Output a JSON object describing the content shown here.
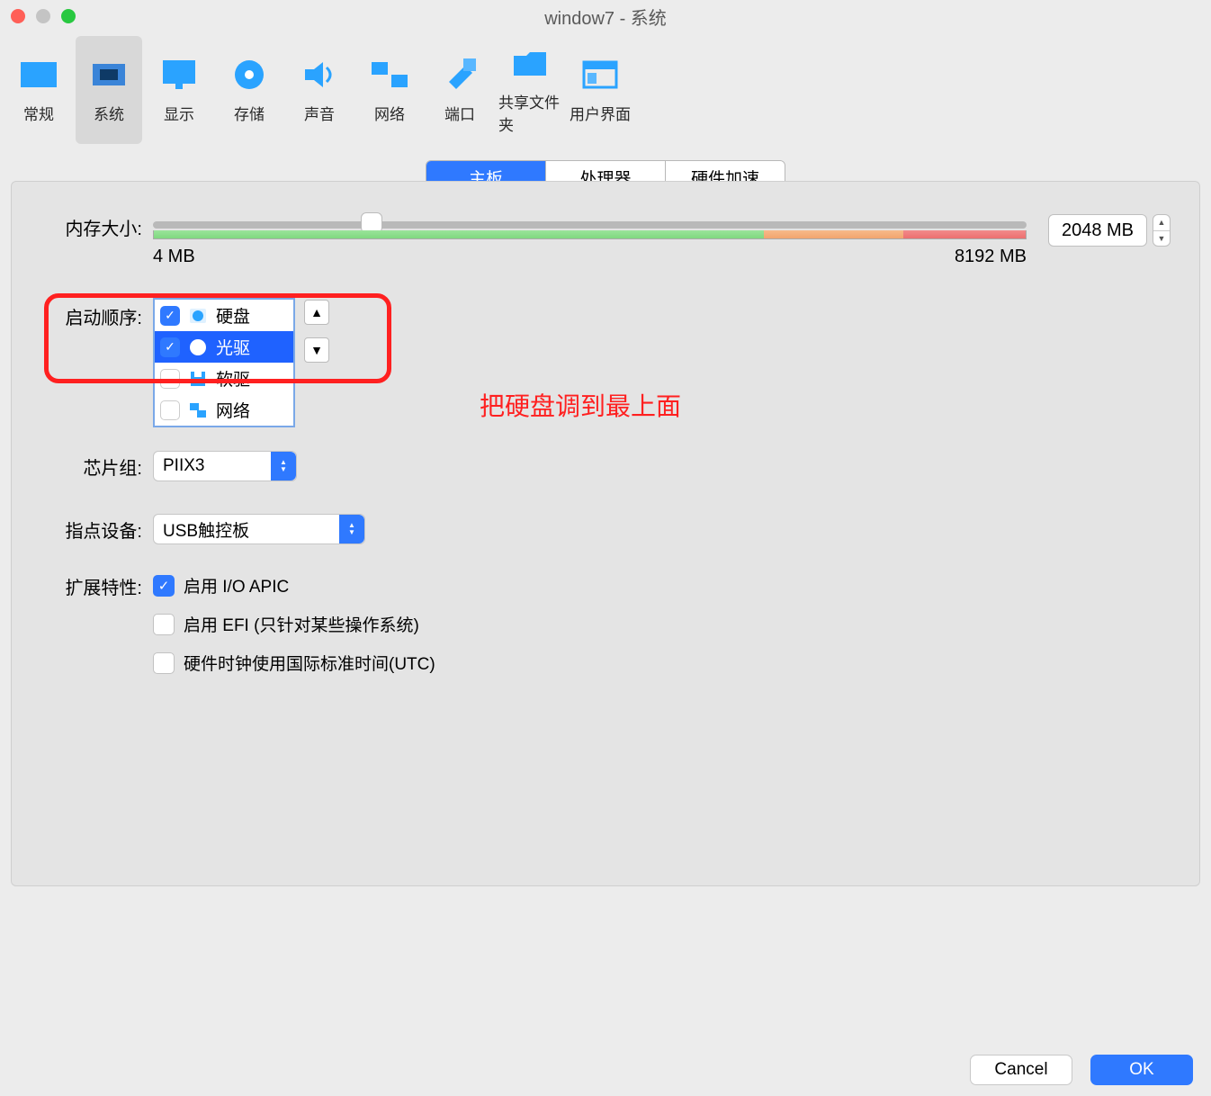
{
  "window": {
    "title": "window7 - 系统"
  },
  "toolbar": [
    {
      "label": "常规",
      "icon": "general"
    },
    {
      "label": "系统",
      "icon": "system",
      "active": true
    },
    {
      "label": "显示",
      "icon": "display"
    },
    {
      "label": "存储",
      "icon": "storage"
    },
    {
      "label": "声音",
      "icon": "audio"
    },
    {
      "label": "网络",
      "icon": "network"
    },
    {
      "label": "端口",
      "icon": "ports"
    },
    {
      "label": "共享文件夹",
      "icon": "shared"
    },
    {
      "label": "用户界面",
      "icon": "ui"
    }
  ],
  "tabs": [
    {
      "label": "主板",
      "active": true
    },
    {
      "label": "处理器",
      "active": false
    },
    {
      "label": "硬件加速",
      "active": false
    }
  ],
  "memory": {
    "label": "内存大小:",
    "value": "2048 MB",
    "min_label": "4 MB",
    "max_label": "8192 MB",
    "thumb_percent": 25,
    "gradient": {
      "green": 70,
      "orange": 16,
      "red": 14
    }
  },
  "boot": {
    "label": "启动顺序:",
    "items": [
      {
        "label": "硬盘",
        "checked": true,
        "selected": false,
        "icon": "hdd"
      },
      {
        "label": "光驱",
        "checked": true,
        "selected": true,
        "icon": "optical"
      },
      {
        "label": "软驱",
        "checked": false,
        "selected": false,
        "icon": "floppy"
      },
      {
        "label": "网络",
        "checked": false,
        "selected": false,
        "icon": "net"
      }
    ]
  },
  "annotation": "把硬盘调到最上面",
  "chipset": {
    "label": "芯片组:",
    "value": "PIIX3"
  },
  "pointing": {
    "label": "指点设备:",
    "value": "USB触控板"
  },
  "extended": {
    "label": "扩展特性:",
    "items": [
      {
        "label": "启用 I/O APIC",
        "checked": true
      },
      {
        "label": "启用 EFI (只针对某些操作系统)",
        "checked": false
      },
      {
        "label": "硬件时钟使用国际标准时间(UTC)",
        "checked": false
      }
    ]
  },
  "buttons": {
    "cancel": "Cancel",
    "ok": "OK"
  }
}
